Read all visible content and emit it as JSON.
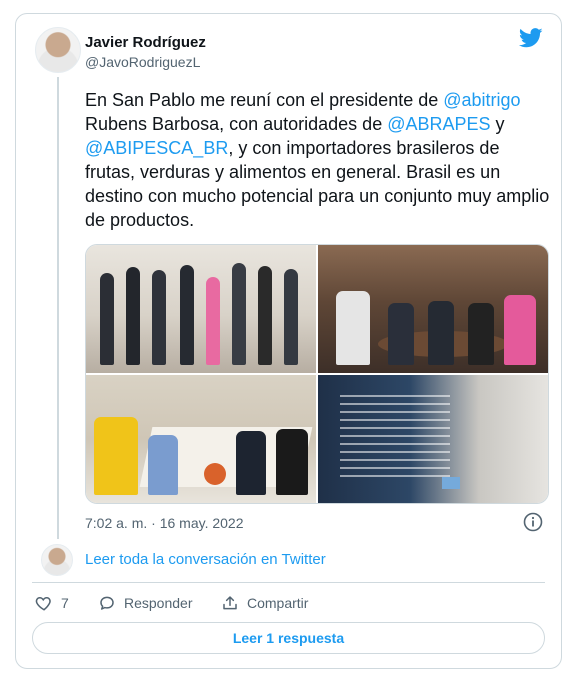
{
  "tweet": {
    "author_name": "Javier Rodríguez",
    "author_handle": "@JavoRodriguezL",
    "text_segments": [
      {
        "text": "En San Pablo me reuní con el presidente de ",
        "mention": false
      },
      {
        "text": "@abitrigo",
        "mention": true
      },
      {
        "text": " Rubens Barbosa, con autoridades de ",
        "mention": false
      },
      {
        "text": "@ABRAPES",
        "mention": true
      },
      {
        "text": " y ",
        "mention": false
      },
      {
        "text": "@ABIPESCA_BR",
        "mention": true
      },
      {
        "text": ", y con importadores brasileros de frutas, verduras y alimentos en general. Brasil es un destino con mucho potencial para un conjunto muy amplio de productos.",
        "mention": false
      }
    ],
    "timestamp": "7:02 a. m. · 16 may. 2022",
    "photos": [
      "group-photo",
      "restaurant-table-photo",
      "meeting-table-photo",
      "product-package-photo"
    ]
  },
  "conversation_link": "Leer toda la conversación en Twitter",
  "actions": {
    "like_count": "7",
    "reply_label": "Responder",
    "share_label": "Compartir"
  },
  "read_replies_label": "Leer 1 respuesta",
  "colors": {
    "accent": "#1d9bf0",
    "text": "#0f1419",
    "secondary": "#536471",
    "border": "#cfd9de"
  },
  "icons": [
    "twitter-bird-icon",
    "info-icon",
    "heart-icon",
    "reply-bubble-icon",
    "share-icon"
  ]
}
